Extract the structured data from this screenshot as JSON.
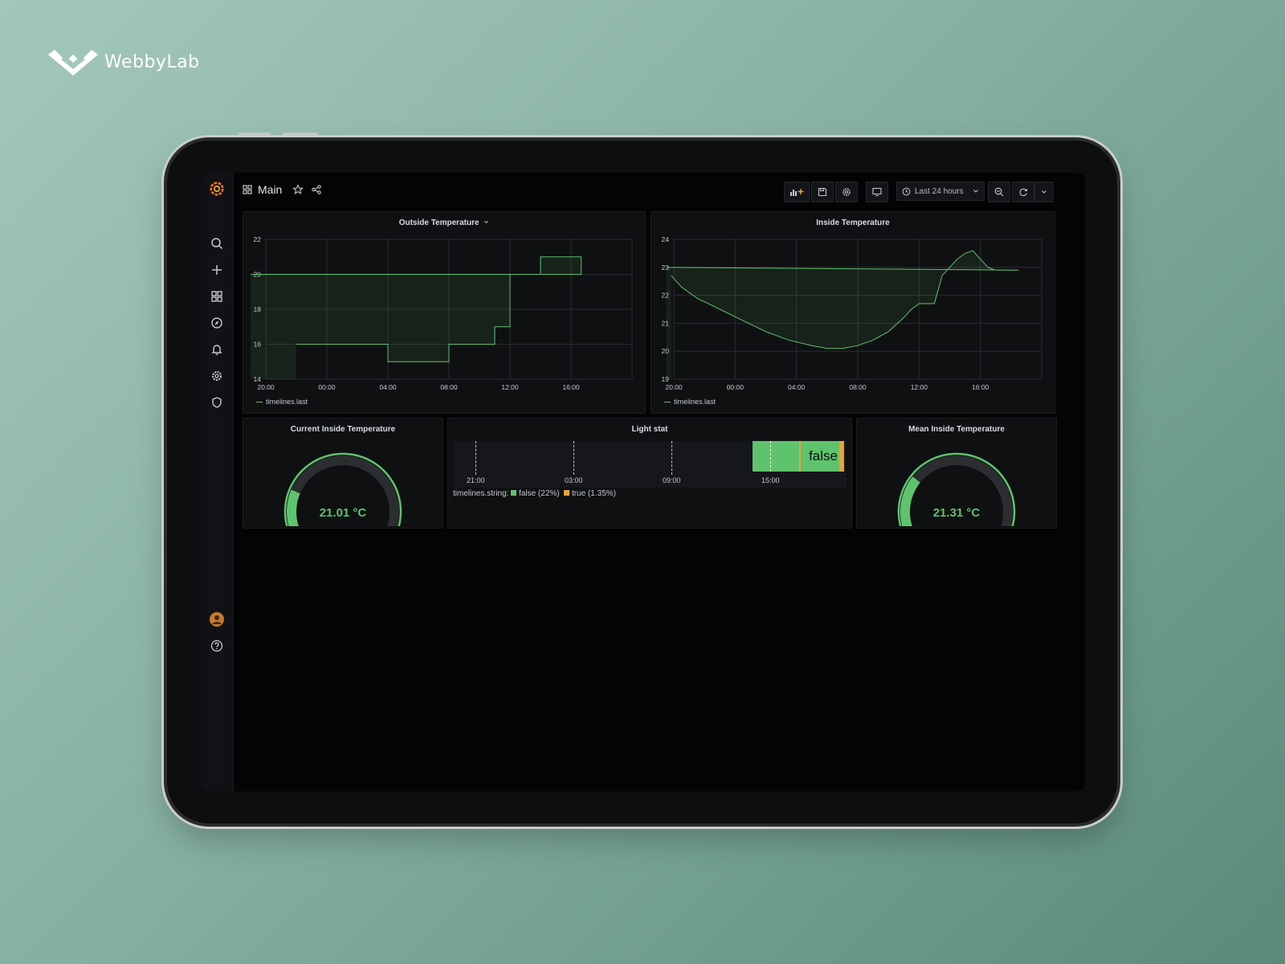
{
  "brand": {
    "name": "WebbyLab"
  },
  "dashboard": {
    "title": "Main",
    "time_range_label": "Last 24 hours"
  },
  "colors": {
    "accent_green": "#5fc36d",
    "accent_orange": "#e8a43a",
    "panel_bg": "#0f1012",
    "grafana_orange": "#f06f23"
  },
  "sidebar_icons": [
    "grafana-logo-icon",
    "search-icon",
    "plus-icon",
    "dashboards-icon",
    "explore-icon",
    "bell-icon",
    "gear-icon",
    "shield-icon",
    "user-avatar-icon",
    "help-icon"
  ],
  "panels": {
    "outside": {
      "title": "Outside Temperature",
      "legend": "timelines.last"
    },
    "inside": {
      "title": "Inside Temperature",
      "legend": "timelines.last"
    },
    "current_gauge": {
      "title": "Current Inside Temperature",
      "value_label": "21.01 °C",
      "fraction": 0.2
    },
    "light_stat": {
      "title": "Light stat",
      "legend_prefix": "timelines.string:",
      "legend_false": "false (22%)",
      "legend_true": "true (1.35%)",
      "state_label": "false",
      "ticks": [
        "21:00",
        "03:00",
        "09:00",
        "15:00"
      ]
    },
    "mean_gauge": {
      "title": "Mean Inside Temperature",
      "value_label": "21.31 °C",
      "fraction": 0.27
    }
  },
  "chart_data": [
    {
      "type": "line",
      "title": "Outside Temperature",
      "x_ticks": [
        "20:00",
        "00:00",
        "04:00",
        "08:00",
        "12:00",
        "16:00"
      ],
      "ylim": [
        14,
        22
      ],
      "y_ticks": [
        14,
        16,
        18,
        20,
        22
      ],
      "grid": true,
      "series": [
        {
          "name": "timelines.last",
          "x": [
            "22:00",
            "04:00",
            "04:00",
            "08:00",
            "08:00",
            "11:00",
            "11:00",
            "12:00",
            "12:00",
            "14:00",
            "14:00",
            "16:40",
            "16:40",
            "19:00"
          ],
          "values": [
            16,
            16,
            15,
            15,
            16,
            16,
            17,
            17,
            20,
            20,
            21,
            21,
            20,
            20
          ]
        }
      ]
    },
    {
      "type": "line",
      "title": "Inside Temperature",
      "x_ticks": [
        "20:00",
        "00:00",
        "04:00",
        "08:00",
        "12:00",
        "16:00"
      ],
      "ylim": [
        19,
        24
      ],
      "y_ticks": [
        19,
        20,
        21,
        22,
        23,
        24
      ],
      "grid": true,
      "series": [
        {
          "name": "timelines.last",
          "x": [
            "19:50",
            "20:30",
            "21:30",
            "23:00",
            "00:30",
            "02:00",
            "03:30",
            "05:00",
            "06:00",
            "07:00",
            "08:00",
            "09:00",
            "10:00",
            "11:00",
            "11:30",
            "12:00",
            "13:00",
            "13:30",
            "14:00",
            "14:30",
            "15:00",
            "15:30",
            "16:00",
            "16:30",
            "17:00",
            "17:30",
            "18:30",
            "19:30"
          ],
          "values": [
            22.7,
            22.3,
            21.9,
            21.5,
            21.1,
            20.7,
            20.4,
            20.2,
            20.1,
            20.1,
            20.2,
            20.4,
            20.7,
            21.2,
            21.5,
            21.7,
            21.7,
            22.7,
            23.0,
            23.3,
            23.5,
            23.6,
            23.3,
            23.0,
            22.9,
            22.9,
            22.9,
            23.0
          ]
        }
      ]
    }
  ]
}
